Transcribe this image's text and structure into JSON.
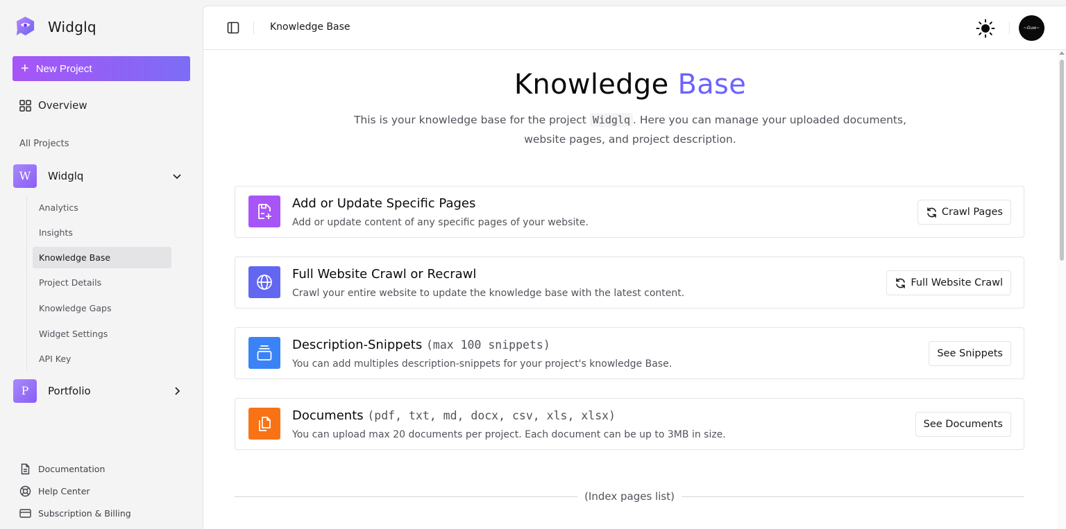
{
  "app": {
    "name": "Widglq"
  },
  "sidebar": {
    "new_project_label": "New Project",
    "overview_label": "Overview",
    "all_projects_label": "All Projects",
    "projects": [
      {
        "initial": "W",
        "name": "Widglq",
        "expanded": true
      },
      {
        "initial": "P",
        "name": "Portfolio",
        "expanded": false
      }
    ],
    "subnav": [
      {
        "label": "Analytics"
      },
      {
        "label": "Insights"
      },
      {
        "label": "Knowledge Base",
        "active": true
      },
      {
        "label": "Project Details"
      },
      {
        "label": "Knowledge Gaps"
      },
      {
        "label": "Widget Settings"
      },
      {
        "label": "API Key"
      }
    ],
    "footer": [
      {
        "label": "Documentation",
        "icon": "document-icon"
      },
      {
        "label": "Help Center",
        "icon": "lifebuoy-icon"
      },
      {
        "label": "Subscription & Billing",
        "icon": "credit-card-icon"
      }
    ]
  },
  "topbar": {
    "breadcrumb": "Knowledge Base",
    "avatar_text": "~Guw~"
  },
  "hero": {
    "title_main": "Knowledge",
    "title_accent": "Base",
    "desc_before": "This is your knowledge base for the project",
    "desc_project": "Widglq",
    "desc_after": ". Here you can manage your uploaded documents, website pages, and project description."
  },
  "cards": [
    {
      "title": "Add or Update Specific Pages",
      "title_extra": "",
      "desc": "Add or update content of any specific pages of your website.",
      "button": "Crawl Pages",
      "icon": "file-plus-icon",
      "color": "#a855f7"
    },
    {
      "title": "Full Website Crawl or Recrawl",
      "title_extra": "",
      "desc": "Crawl your entire website to update the knowledge base with the latest content.",
      "button": "Full Website Crawl",
      "icon": "globe-icon",
      "color": "#6366f1"
    },
    {
      "title": "Description-Snippets",
      "title_extra": "(max 100 snippets)",
      "desc": "You can add multiples description-snippets for your project's knowledge Base.",
      "button": "See Snippets",
      "icon": "stack-icon",
      "color": "#3b82f6"
    },
    {
      "title": "Documents",
      "title_extra": "(pdf, txt, md, docx, csv, xls, xlsx)",
      "desc": "You can upload max 20 documents per project. Each document can be up to 3MB in size.",
      "button": "See Documents",
      "icon": "files-icon",
      "color": "#f97316"
    }
  ],
  "index_label": "(Index pages list)"
}
